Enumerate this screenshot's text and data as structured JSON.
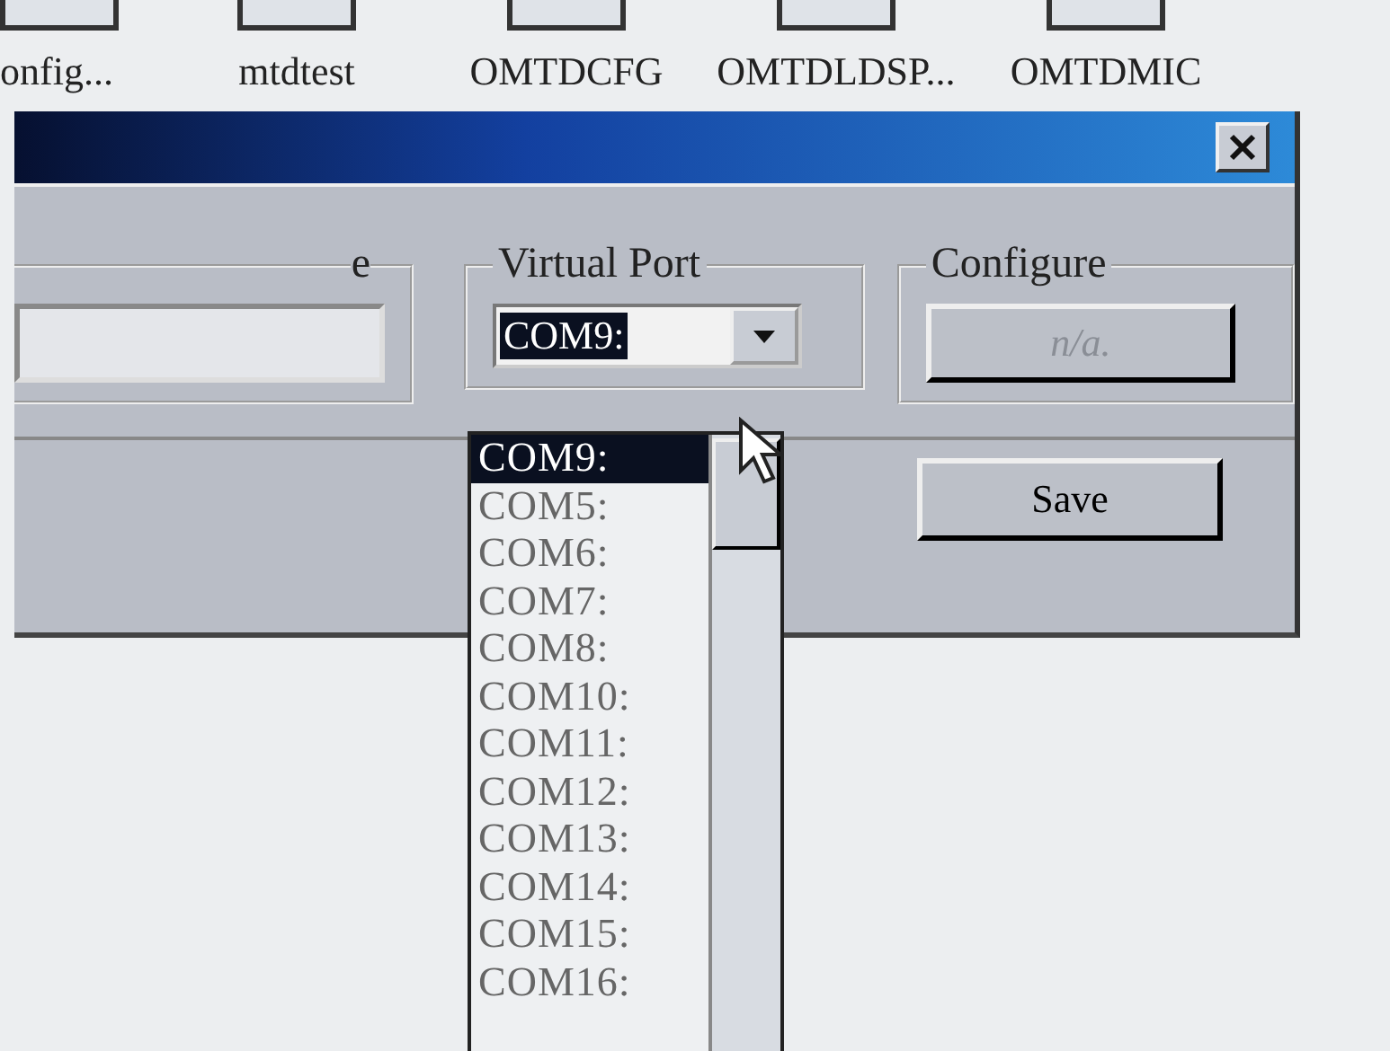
{
  "desktop_icons": [
    {
      "label": "onfig..."
    },
    {
      "label": "mtdtest"
    },
    {
      "label": "OMTDCFG"
    },
    {
      "label": "OMTDLDSP..."
    },
    {
      "label": "OMTDMIC"
    }
  ],
  "dialog": {
    "name_group": {
      "label": "e"
    },
    "port_group": {
      "label": "Virtual Port",
      "value": "COM9:"
    },
    "configure_group": {
      "label": "Configure",
      "button": {
        "label": "n/a.",
        "disabled": true
      }
    },
    "save_button": "Save"
  },
  "port_list": [
    {
      "label": "COM9:",
      "selected": true
    },
    {
      "label": "COM5:",
      "selected": false
    },
    {
      "label": "COM6:",
      "selected": false
    },
    {
      "label": "COM7:",
      "selected": false
    },
    {
      "label": "COM8:",
      "selected": false
    },
    {
      "label": "COM10:",
      "selected": false
    },
    {
      "label": "COM11:",
      "selected": false
    },
    {
      "label": "COM12:",
      "selected": false
    },
    {
      "label": "COM13:",
      "selected": false
    },
    {
      "label": "COM14:",
      "selected": false
    },
    {
      "label": "COM15:",
      "selected": false
    },
    {
      "label": "COM16:",
      "selected": false
    }
  ]
}
